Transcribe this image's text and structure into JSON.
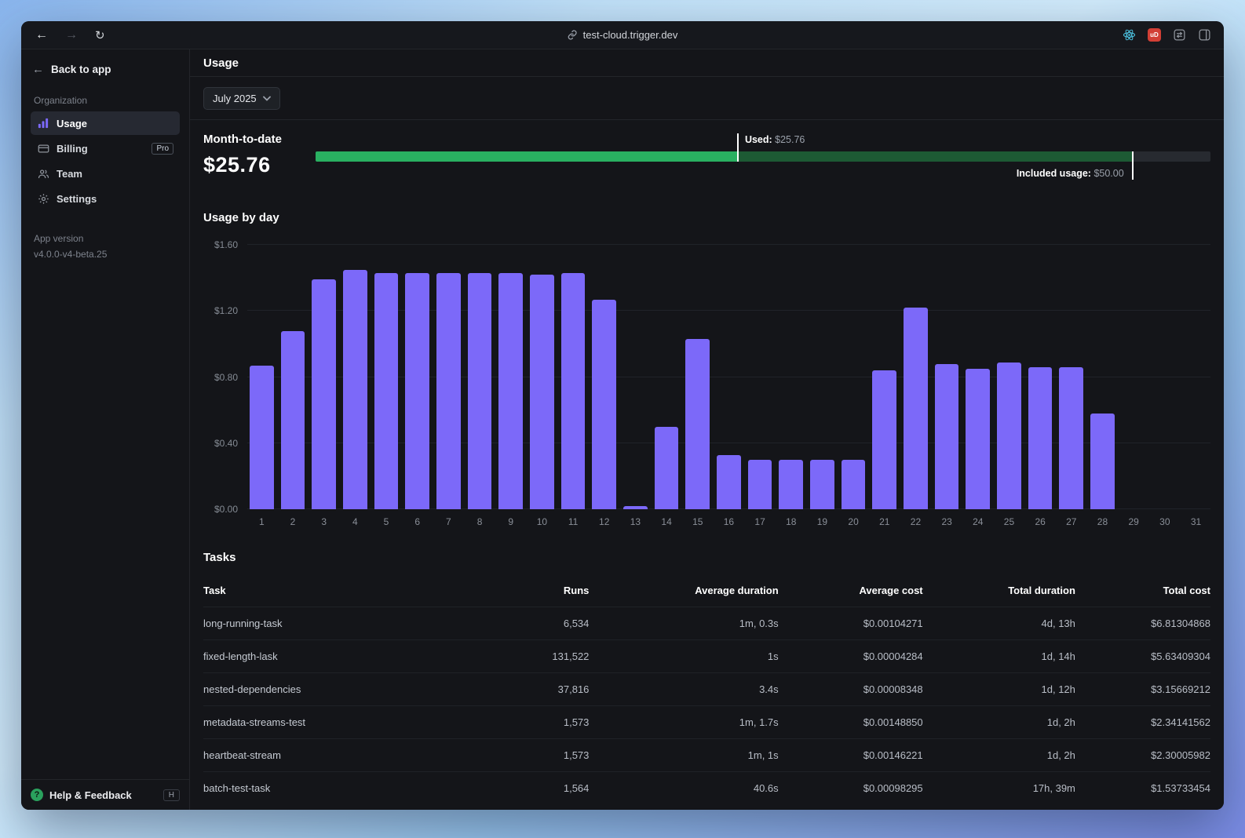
{
  "browser": {
    "url": "test-cloud.trigger.dev",
    "icons": [
      "back-icon",
      "forward-icon",
      "reload-icon",
      "link-icon",
      "react-devtools-icon",
      "ublock-icon",
      "extension-panel-icon",
      "sidebar-toggle-icon"
    ],
    "ublock_text": "uD"
  },
  "sidebar": {
    "back_label": "Back to app",
    "section_label": "Organization",
    "items": [
      {
        "label": "Usage",
        "active": true
      },
      {
        "label": "Billing",
        "badge": "Pro"
      },
      {
        "label": "Team"
      },
      {
        "label": "Settings"
      }
    ],
    "app_version_label": "App version",
    "app_version_value": "v4.0.0-v4-beta.25",
    "help_label": "Help & Feedback",
    "help_shortcut": "H"
  },
  "header": {
    "title": "Usage"
  },
  "usage": {
    "month_selector": "July 2025",
    "month_to_date_label": "Month-to-date",
    "month_to_date_value": "$25.76",
    "used_label": "Used:",
    "used_value": "$25.76",
    "included_label": "Included usage:",
    "included_value": "$50.00",
    "used_pct": 47.1,
    "included_pct": 91.2,
    "used_color": "#29b061",
    "included_color": "#1d5a34"
  },
  "chart_data": {
    "type": "bar",
    "title": "Usage by day",
    "x": [
      1,
      2,
      3,
      4,
      5,
      6,
      7,
      8,
      9,
      10,
      11,
      12,
      13,
      14,
      15,
      16,
      17,
      18,
      19,
      20,
      21,
      22,
      23,
      24,
      25,
      26,
      27,
      28,
      29,
      30,
      31
    ],
    "values": [
      0.87,
      1.08,
      1.39,
      1.45,
      1.43,
      1.43,
      1.43,
      1.43,
      1.43,
      1.42,
      1.43,
      1.27,
      0.02,
      0.5,
      1.03,
      0.33,
      0.3,
      0.3,
      0.3,
      0.3,
      0.84,
      1.22,
      0.88,
      0.85,
      0.89,
      0.86,
      0.86,
      0.58,
      0,
      0,
      0
    ],
    "yticks": [
      "$0.00",
      "$0.40",
      "$0.80",
      "$1.20",
      "$1.60"
    ],
    "ylim": [
      0,
      1.6
    ],
    "xlabel": "",
    "ylabel": "",
    "grid": true,
    "legend": false,
    "bar_color": "#7c69f9"
  },
  "tasks": {
    "title": "Tasks",
    "columns": [
      "Task",
      "Runs",
      "Average duration",
      "Average cost",
      "Total duration",
      "Total cost"
    ],
    "rows": [
      [
        "long-running-task",
        "6,534",
        "1m, 0.3s",
        "$0.00104271",
        "4d, 13h",
        "$6.81304868"
      ],
      [
        "fixed-length-lask",
        "131,522",
        "1s",
        "$0.00004284",
        "1d, 14h",
        "$5.63409304"
      ],
      [
        "nested-dependencies",
        "37,816",
        "3.4s",
        "$0.00008348",
        "1d, 12h",
        "$3.15669212"
      ],
      [
        "metadata-streams-test",
        "1,573",
        "1m, 1.7s",
        "$0.00148850",
        "1d, 2h",
        "$2.34141562"
      ],
      [
        "heartbeat-stream",
        "1,573",
        "1m, 1s",
        "$0.00146221",
        "1d, 2h",
        "$2.30005982"
      ],
      [
        "batch-test-task",
        "1,564",
        "40.6s",
        "$0.00098295",
        "17h, 39m",
        "$1.53733454"
      ]
    ]
  }
}
